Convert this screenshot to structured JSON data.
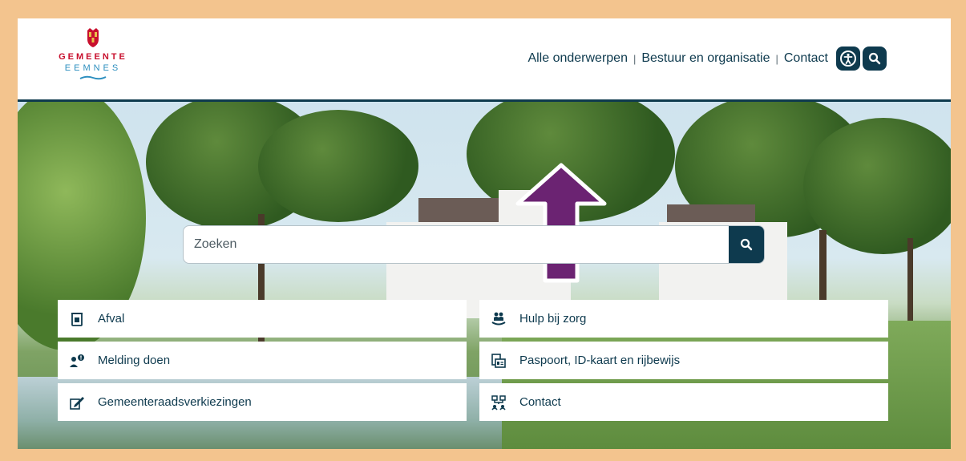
{
  "header": {
    "logo": {
      "line1": "GEMEENTE",
      "line2": "EEMNES",
      "crest_color": "#c8102e",
      "wave_color": "#2d8fbf"
    },
    "nav": [
      {
        "label": "Alle onderwerpen"
      },
      {
        "label": "Bestuur en organisatie"
      },
      {
        "label": "Contact"
      }
    ],
    "separator": "|",
    "icons": {
      "accessibility": "accessibility-icon",
      "search": "search-icon"
    }
  },
  "search": {
    "placeholder": "Zoeken",
    "value": "",
    "button_icon": "search-icon"
  },
  "tiles": [
    {
      "label": "Afval",
      "icon": "waste-bin-icon"
    },
    {
      "label": "Hulp bij zorg",
      "icon": "care-help-icon"
    },
    {
      "label": "Melding doen",
      "icon": "report-person-icon"
    },
    {
      "label": "Paspoort, ID-kaart en rijbewijs",
      "icon": "id-card-icon"
    },
    {
      "label": "Gemeenteraadsverkiezingen",
      "icon": "pen-write-icon"
    },
    {
      "label": "Contact",
      "icon": "contact-network-icon"
    }
  ],
  "colors": {
    "brand": "#0e3a4e",
    "frame": "#f3c48e",
    "arrow": "#6b2372"
  }
}
